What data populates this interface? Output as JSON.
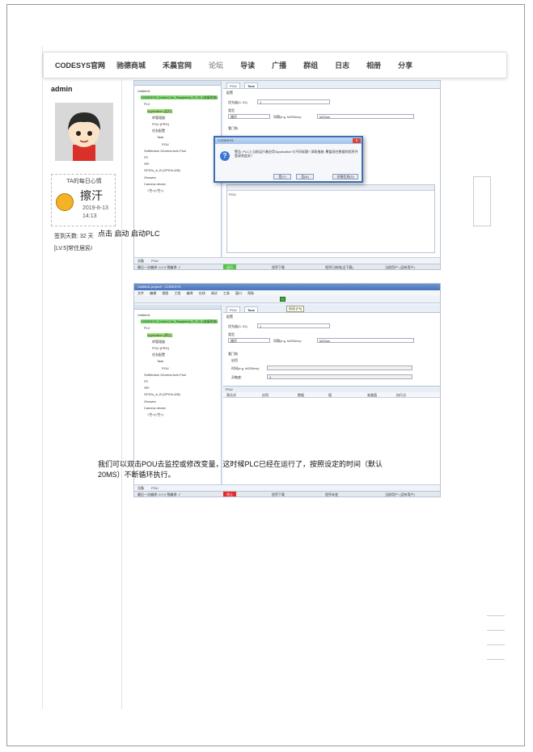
{
  "nav": {
    "brand": "CODESYS官网",
    "items": [
      "驰德商城",
      "禾晨官网",
      "论坛",
      "导读",
      "广播",
      "群组",
      "日志",
      "相册",
      "分享"
    ]
  },
  "profile": {
    "username": "admin",
    "mood_title": "TA的每日心情",
    "mood_text": "擦汗",
    "mood_date": "2019-8-13 14:13",
    "sign_days": "签到天数: 32 天",
    "level": "[LV.5]常住居民I"
  },
  "shot1": {
    "tree": [
      "Untitled1",
      "CODESYS_Control_for_Raspberry_Pi_SL (连接状态)",
      "PLC",
      "Application [运行]",
      "库管理器",
      "POU (PRG)",
      "任务配置",
      "Task",
      "POU",
      "SoftMotion General Axis Pool",
      "I²C",
      "SPI",
      "GPIOs_A_B (GPIOs A/B)",
      "Onewire",
      "Camera device",
      "<空>(<空>)"
    ],
    "tabs": [
      "POU",
      "Task"
    ],
    "config_label": "配置",
    "priority_label": "优先级(0..31):",
    "priority_value": "1",
    "type_label": "类型",
    "type_value": "循环",
    "interval_label": "间隔(e.g. t#200ms):",
    "interval_value": "t#20ms",
    "watchdog_label": "看门狗",
    "pou_col": "POU",
    "dialog_title": "CODESYS",
    "dialog_msg": "警告: PLC上当前运行着应用'Application'与不同标题? 采取措施: 覆盖现在数据的程序并登录到此处?",
    "btn_yes": "是(Y)",
    "btn_no": "否(N)",
    "btn_detail": "详细信息(D)",
    "status_run": "运行",
    "status_prog": "程序下载",
    "status_changed": "程序已修改(全下载)",
    "status_user": "当前用户: (没有用户)",
    "bottom_tabs": [
      "设备",
      "POU"
    ],
    "msg_bar": "最后一次编译: 0 0 0 预编译: ✓"
  },
  "caption1": "点击 启动 启动PLC",
  "shot2": {
    "titlebar": "Untitled1.project* - CODESYS",
    "menu": [
      "文件",
      "编辑",
      "视图",
      "工程",
      "编译",
      "在线",
      "调试",
      "工具",
      "窗口",
      "帮助"
    ],
    "start_tooltip": "启动 [F5]",
    "tree": [
      "Untitled1",
      "CODESYS_Control_for_Raspberry_Pi_SL (连接状态)",
      "PLC",
      "Application [停止]",
      "库管理器",
      "POU (PRG)",
      "任务配置",
      "Task",
      "POU",
      "SoftMotion General Axis Pool",
      "I²C",
      "SPI",
      "GPIOs_A_B (GPIOs A/B)",
      "Onewire",
      "Camera device",
      "<空>(<空>)"
    ],
    "tabs": [
      "POU",
      "Task"
    ],
    "config_label": "配置",
    "priority_label": "优先级(0..31):",
    "priority_value": "1",
    "type_label": "类型",
    "type_value": "循环",
    "interval_label": "间隔(e.g. t#200ms):",
    "interval_value": "t#20ms",
    "watchdog_label": "看门狗",
    "watchdog_enable": "启用",
    "time_label": "时间(e.g. t#200ms):",
    "sensitivity_label": "灵敏度:",
    "sensitivity_value": "1",
    "pou_header": "POU",
    "columns": [
      "表达式",
      "应用",
      "数据",
      "值",
      "准备值",
      "执行点"
    ],
    "status_stop": "停止",
    "status_prog": "程序下载",
    "status_changed": "程序未变",
    "status_user": "当前用户: (没有用户)",
    "bottom_tabs": [
      "设备",
      "POU"
    ],
    "msg_bar": "最后一次编译: 0 0 0 预编译: ✓"
  },
  "caption2": "我们可以双击POU去监控或修改变量，这时候PLC已经在运行了，按照设定的时间（默认20MS）不断循环执行。",
  "colors": {
    "run": "#54c642",
    "stop": "#e32b2b",
    "selected": "#7ddc6b",
    "dialog_border": "#3d6fb6"
  }
}
